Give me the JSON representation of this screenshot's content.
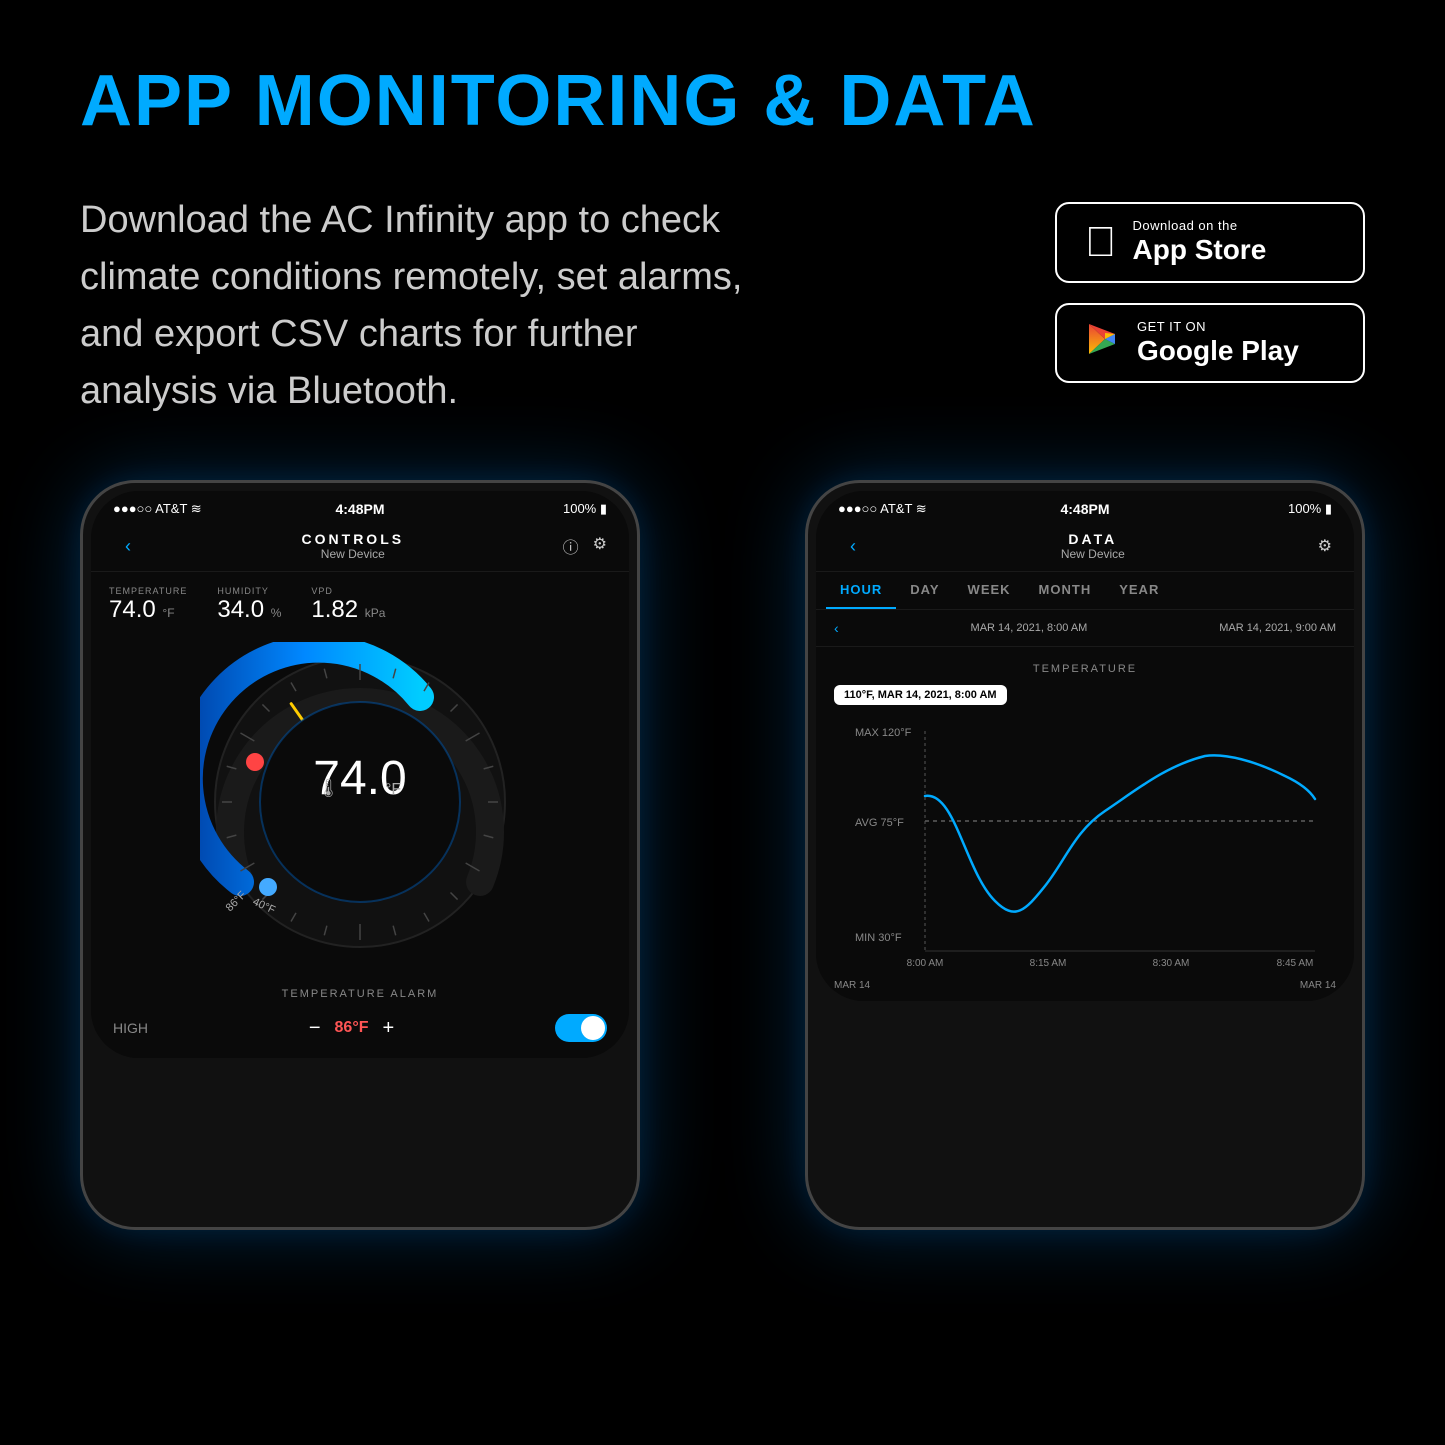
{
  "page": {
    "background": "#000000",
    "title": "APP MONITORING & DATA",
    "description": "Download the AC Infinity app to check climate conditions remotely, set alarms, and export CSV charts for further analysis via Bluetooth.",
    "appstore": {
      "apple": {
        "small_text": "Download on the",
        "big_text": "App Store"
      },
      "google": {
        "small_text": "GET IT ON",
        "big_text": "Google Play"
      }
    },
    "phone_controls": {
      "status_left": "●●●○○  AT&T  ⌾",
      "status_time": "4:48PM",
      "status_right": "100%",
      "nav_title": "CONTROLS",
      "nav_subtitle": "New Device",
      "temperature_label": "TEMPERATURE",
      "temperature_value": "74.0",
      "temperature_unit": "°F",
      "humidity_label": "HUMIDITY",
      "humidity_value": "34.0",
      "humidity_unit": "%",
      "vpd_label": "VPD",
      "vpd_value": "1.82",
      "vpd_unit": "kPa",
      "gauge_value": "74.0",
      "gauge_unit": "°F",
      "gauge_max": "86°F",
      "gauge_min": "40°F",
      "alarm_title": "TEMPERATURE ALARM",
      "alarm_high_label": "HIGH",
      "alarm_high_value": "86°F"
    },
    "phone_data": {
      "status_left": "●●●○○  AT&T  ⌾",
      "status_time": "4:48PM",
      "status_right": "100%",
      "nav_title": "DATA",
      "nav_subtitle": "New Device",
      "tabs": [
        "HOUR",
        "DAY",
        "WEEK",
        "MONTH",
        "YEAR"
      ],
      "active_tab": "HOUR",
      "date_start": "MAR 14, 2021, 8:00 AM",
      "date_end": "MAR 14, 2021, 9:00 AM",
      "chart_title": "TEMPERATURE",
      "tooltip": "110°F, MAR 14, 2021, 8:00 AM",
      "max_label": "MAX 120°F",
      "avg_label": "AVG 75°F",
      "min_label": "MIN 30°F",
      "x_labels": [
        "8:00 AM",
        "8:15 AM",
        "8:30 AM",
        "8:45 AM"
      ],
      "x_date_labels": [
        "MAR 14",
        "",
        "",
        "MAR 14"
      ]
    }
  }
}
